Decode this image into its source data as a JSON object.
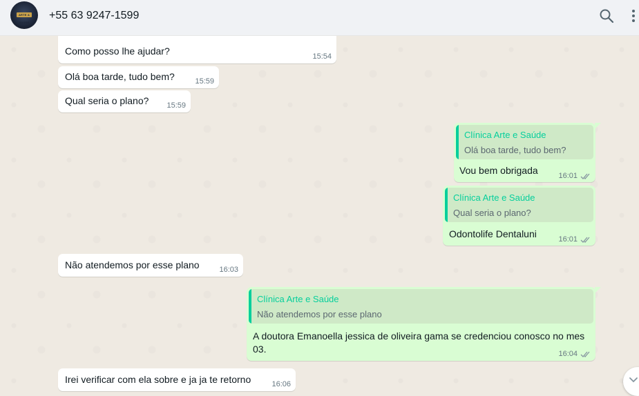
{
  "header": {
    "contact_name": "+55 63 9247-1599",
    "avatar_text": "ARTE & SAÚDE",
    "icons": [
      "search-icon",
      "menu-icon"
    ]
  },
  "messages": [
    {
      "direction": "in",
      "text": "Como posso lhe ajudar?",
      "time": "15:54"
    },
    {
      "direction": "in",
      "text": "Olá boa tarde, tudo bem?",
      "time": "15:59"
    },
    {
      "direction": "in",
      "text": "Qual seria o plano?",
      "time": "15:59"
    },
    {
      "direction": "out",
      "quote_name": "Clínica Arte e Saúde",
      "quote_text": "Olá boa tarde, tudo bem?",
      "text": "Vou bem obrigada",
      "time": "16:01",
      "status": "read"
    },
    {
      "direction": "out",
      "quote_name": "Clínica Arte e Saúde",
      "quote_text": "Qual seria o plano?",
      "text": "Odontolife Dentaluni",
      "time": "16:01",
      "status": "read"
    },
    {
      "direction": "in",
      "text": "Não atendemos por esse plano",
      "time": "16:03"
    },
    {
      "direction": "out",
      "quote_name": "Clínica Arte e Saúde",
      "quote_text": "Não atendemos por esse plano",
      "text_line1": "A doutora Emanoella jessica de oliveira gama se credenciou conosco no mes",
      "text_line2": "03.",
      "time": "16:04",
      "status": "read"
    },
    {
      "direction": "in",
      "text": "Irei verificar com ela sobre e ja ja te retorno",
      "time": "16:06"
    }
  ],
  "colors": {
    "incoming_bubble": "#ffffff",
    "outgoing_bubble": "#d9fdd3",
    "quote_accent": "#06cf9c",
    "chat_background": "#efeae2",
    "header_background": "#f0f2f5"
  }
}
